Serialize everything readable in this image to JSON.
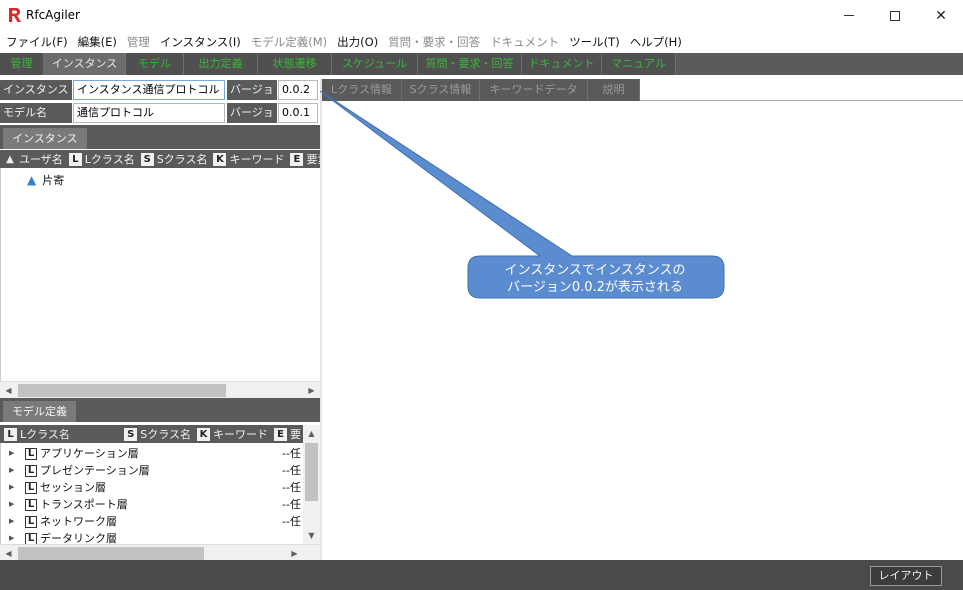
{
  "window": {
    "title": "RfcAgiler",
    "minimize": "—",
    "maximize": "☐",
    "close": "✕"
  },
  "menu": [
    {
      "label": "ファイル(F)",
      "enabled": true
    },
    {
      "label": "編集(E)",
      "enabled": true
    },
    {
      "label": "管理",
      "enabled": false
    },
    {
      "label": "インスタンス(I)",
      "enabled": true
    },
    {
      "label": "モデル定義(M)",
      "enabled": false
    },
    {
      "label": "出力(O)",
      "enabled": true
    },
    {
      "label": "質問・要求・回答",
      "enabled": false
    },
    {
      "label": "ドキュメント",
      "enabled": false
    },
    {
      "label": "ツール(T)",
      "enabled": true
    },
    {
      "label": "ヘルプ(H)",
      "enabled": true
    }
  ],
  "main_tabs": [
    "管理",
    "インスタンス",
    "モデル",
    "出力定義",
    "状態遷移",
    "スケジュール",
    "質問・要求・回答",
    "ドキュメント",
    "マニュアル"
  ],
  "main_tab_active": "インスタンス",
  "form": {
    "instance_label": "インスタンス名",
    "instance_value": "インスタンス通信プロトコル",
    "instance_version_label": "バージョン",
    "instance_version_value": "0.0.2",
    "model_label": "モデル名",
    "model_value": "通信プロトコル",
    "model_version_label": "バージョン",
    "model_version_value": "0.0.1"
  },
  "instance_panel": {
    "tab": "インスタンス",
    "columns": [
      {
        "badge": "",
        "label": "ユーザ名"
      },
      {
        "badge": "L",
        "label": "Lクラス名"
      },
      {
        "badge": "S",
        "label": "Sクラス名"
      },
      {
        "badge": "K",
        "label": "キーワード"
      },
      {
        "badge": "E",
        "label": "要素"
      }
    ],
    "rows": [
      {
        "user": "片寄"
      }
    ]
  },
  "model_panel": {
    "tab": "モデル定義",
    "columns": [
      {
        "badge": "L",
        "label": "Lクラス名"
      },
      {
        "badge": "S",
        "label": "Sクラス名"
      },
      {
        "badge": "K",
        "label": "キーワード"
      },
      {
        "badge": "E",
        "label": "要"
      }
    ],
    "rows": [
      {
        "name": "アプリケーション層",
        "suffix": "--任"
      },
      {
        "name": "プレゼンテーション層",
        "suffix": "--任"
      },
      {
        "name": "セッション層",
        "suffix": "--任"
      },
      {
        "name": "トランスポート層",
        "suffix": "--任"
      },
      {
        "name": "ネットワーク層",
        "suffix": "--任"
      },
      {
        "name": "データリンク層",
        "suffix": ""
      }
    ]
  },
  "right_tabs": [
    "Lクラス情報",
    "Sクラス情報",
    "キーワードデータ",
    "説明"
  ],
  "callout": {
    "line1": "インスタンスでインスタンスの",
    "line2": "バージョン0.0.2が表示される",
    "fill": "#5b8ccf",
    "stroke": "#3f6fae"
  },
  "statusbar": {
    "layout_button": "レイアウト"
  },
  "colors": {
    "dark_bar": "#5a5a5a",
    "tab_green": "#3ab43a",
    "user_icon": "#2f7fd6",
    "logo_red": "#d8282a"
  }
}
